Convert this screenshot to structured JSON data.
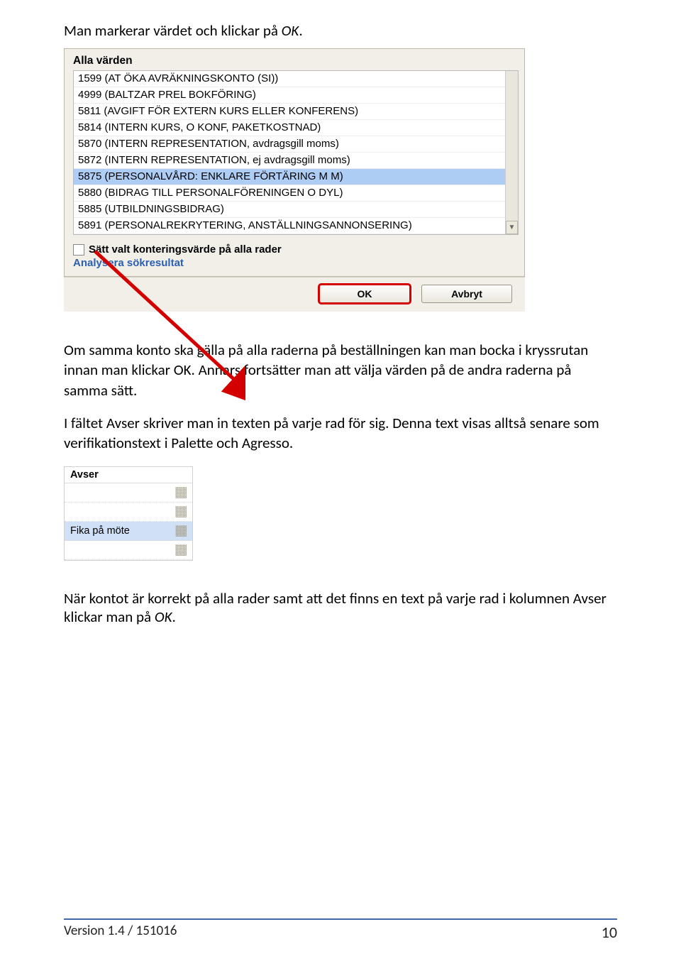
{
  "intro_prefix": "Man markerar värdet och klickar på ",
  "intro_em": "OK",
  "intro_suffix": ".",
  "screenshot1": {
    "header": "Alla värden",
    "rows": [
      "1599 (AT ÖKA AVRÄKNINGSKONTO (SI))",
      "4999 (BALTZAR PREL BOKFÖRING)",
      "5811 (AVGIFT FÖR EXTERN KURS ELLER KONFERENS)",
      "5814 (INTERN KURS, O KONF, PAKETKOSTNAD)",
      "5870 (INTERN REPRESENTATION, avdragsgill moms)",
      "5872 (INTERN REPRESENTATION, ej avdragsgill moms)",
      "5875 (PERSONALVÅRD: ENKLARE FÖRTÄRING M M)",
      "5880 (BIDRAG TILL PERSONALFÖRENINGEN O DYL)",
      "5885 (UTBILDNINGSBIDRAG)",
      "5891 (PERSONALREKRYTERING, ANSTÄLLNINGSANNONSERING)"
    ],
    "selected_index": 6,
    "checkbox_label": "Sätt valt konteringsvärde på alla rader",
    "analyze_label": "Analysera sökresultat",
    "ok_label": "OK",
    "cancel_label": "Avbryt"
  },
  "para1": "Om samma konto ska gälla på alla raderna på beställningen kan man bocka i kryssrutan innan man klickar OK. Annars fortsätter man att välja värden på de andra raderna på samma sätt.",
  "para2": "I fältet Avser skriver man in texten på varje rad för sig. Denna text visas alltså senare som verifikationstext i Palette och Agresso.",
  "screenshot2": {
    "header": "Avser",
    "value": "Fika på möte"
  },
  "finaltext_prefix": "När kontot är korrekt på alla rader samt att det finns en text på varje rad i kolumnen Avser klickar man på ",
  "finaltext_em": "OK",
  "finaltext_suffix": ".",
  "footer_left": "Version 1.4 / 151016",
  "footer_right": "10"
}
